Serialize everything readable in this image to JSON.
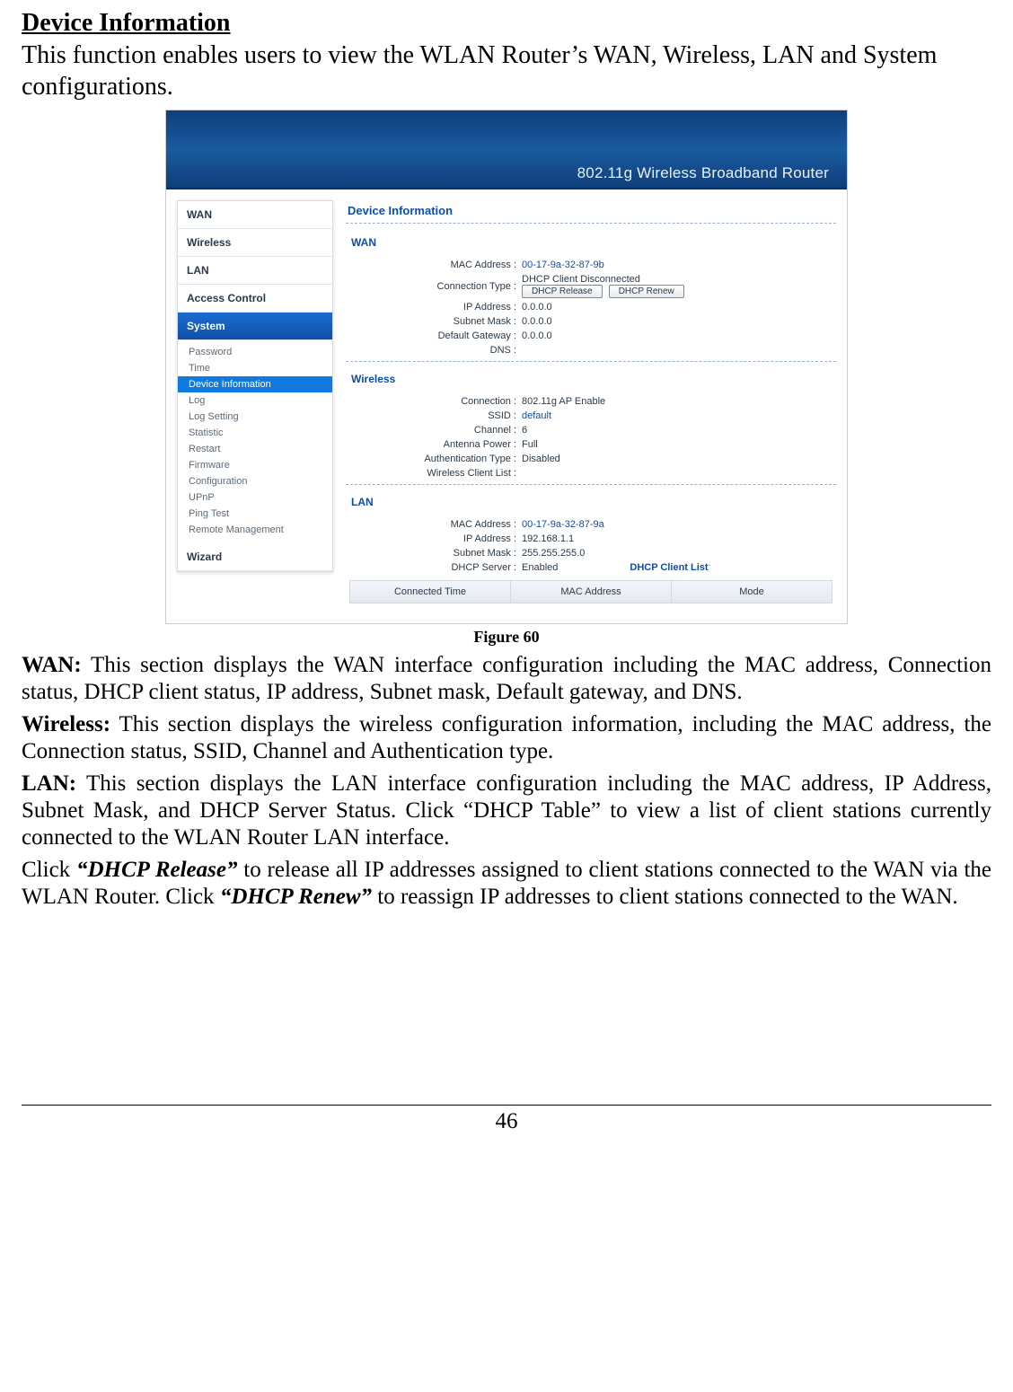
{
  "doc": {
    "heading": "Device Information",
    "intro": "This function enables users to view the WLAN Router’s WAN, Wireless, LAN and System configurations.",
    "figure_label": "Figure 60",
    "wan_desc_lead": "WAN:",
    "wan_desc": " This section displays the WAN interface configuration including the MAC address, Connection status, DHCP client status, IP address, Subnet mask, Default gateway, and DNS.",
    "wl_desc_lead": "Wireless:",
    "wl_desc": " This section displays the wireless configuration information, including the MAC address, the Connection status, SSID, Channel and Authentication type.",
    "lan_desc_lead": "LAN:",
    "lan_desc": " This section displays the LAN interface configuration including the MAC address, IP Address, Subnet Mask, and DHCP Server Status. Click “DHCP Table” to view a list of client stations currently connected to the WLAN Router LAN interface.",
    "rel_pre": "Click ",
    "rel_em": "“DHCP Release”",
    "rel_mid": " to release all IP addresses assigned to client stations connected to the WAN via the WLAN Router. Click ",
    "ren_em": "“DHCP Renew”",
    "ren_post": " to reassign IP addresses to client stations connected to the WAN.",
    "page_number": "46"
  },
  "ui": {
    "banner": "802.11g Wireless Broadband Router",
    "nav": {
      "wan": "WAN",
      "wireless": "Wireless",
      "lan": "LAN",
      "access": "Access Control",
      "system": "System",
      "wizard": "Wizard"
    },
    "sys_sub": [
      "Password",
      "Time",
      "Device Information",
      "Log",
      "Log Setting",
      "Statistic",
      "Restart",
      "Firmware",
      "Configuration",
      "UPnP",
      "Ping Test",
      "Remote Management"
    ],
    "content_title": "Device Information",
    "sections": {
      "wan": "WAN",
      "wireless": "Wireless",
      "lan": "LAN"
    },
    "wan": {
      "mac_lbl": "MAC Address :",
      "mac": "00-17-9a-32-87-9b",
      "conn_lbl": "Connection Type :",
      "conn_status": "DHCP Client Disconnected",
      "btn_release": "DHCP Release",
      "btn_renew": "DHCP Renew",
      "ip_lbl": "IP Address :",
      "ip": "0.0.0.0",
      "mask_lbl": "Subnet Mask :",
      "mask": "0.0.0.0",
      "gw_lbl": "Default Gateway :",
      "gw": "0.0.0.0",
      "dns_lbl": "DNS :",
      "dns": ""
    },
    "wireless": {
      "conn_lbl": "Connection :",
      "conn": "802.11g AP Enable",
      "ssid_lbl": "SSID :",
      "ssid": "default",
      "chan_lbl": "Channel :",
      "chan": "6",
      "ant_lbl": "Antenna Power :",
      "ant": "Full",
      "auth_lbl": "Authentication Type :",
      "auth": "Disabled",
      "clients_lbl": "Wireless Client List :",
      "clients": ""
    },
    "lan": {
      "mac_lbl": "MAC Address :",
      "mac": "00-17-9a-32-87-9a",
      "ip_lbl": "IP Address :",
      "ip": "192.168.1.1",
      "mask_lbl": "Subnet Mask :",
      "mask": "255.255.255.0",
      "dhcp_lbl": "DHCP Server :",
      "dhcp": "Enabled",
      "dhcp_link": "DHCP Client List"
    },
    "table": {
      "c1": "Connected Time",
      "c2": "MAC Address",
      "c3": "Mode"
    }
  }
}
